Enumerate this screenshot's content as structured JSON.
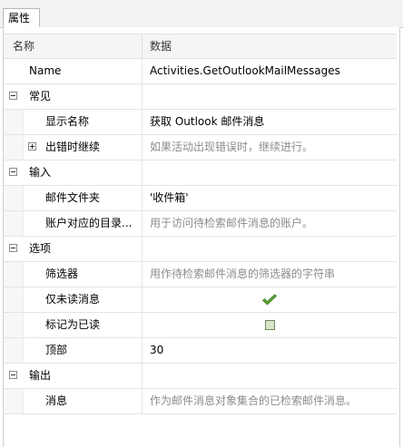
{
  "tab": {
    "label": "属性"
  },
  "header": {
    "name_col": "名称",
    "data_col": "数据"
  },
  "rows": {
    "name": {
      "label": "Name",
      "value": "Activities.GetOutlookMailMessages"
    },
    "common": {
      "category": "常见",
      "display_name": {
        "label": "显示名称",
        "value": "获取 Outlook 邮件消息"
      },
      "continue_on_error": {
        "label": "出错时继续",
        "value": "如果活动出现错误时，继续进行。"
      }
    },
    "input": {
      "category": "输入",
      "mail_folder": {
        "label": "邮件文件夹",
        "value": "'收件箱'"
      },
      "account": {
        "label": "账户对应的目录...",
        "value": "用于访问待检索邮件消息的账户。"
      }
    },
    "options": {
      "category": "选项",
      "filter": {
        "label": "筛选器",
        "value": "用作待检索邮件消息的筛选器的字符串"
      },
      "only_unread": {
        "label": "仅未读消息",
        "checked": true
      },
      "mark_as_read": {
        "label": "标记为已读",
        "checked": false
      },
      "top": {
        "label": "顶部",
        "value": "30"
      }
    },
    "output": {
      "category": "输出",
      "messages": {
        "label": "消息",
        "value": "作为邮件消息对象集合的已检索邮件消息。"
      }
    }
  },
  "colors": {
    "check_green": "#5ea33a",
    "muted_text": "#8c8c8c",
    "checkbox_fill": "#d7e6c8"
  },
  "icons": {
    "collapse": "minus-box-icon",
    "expand": "plus-box-icon",
    "checked": "checkmark-icon",
    "unchecked": "checkbox-empty-icon"
  }
}
